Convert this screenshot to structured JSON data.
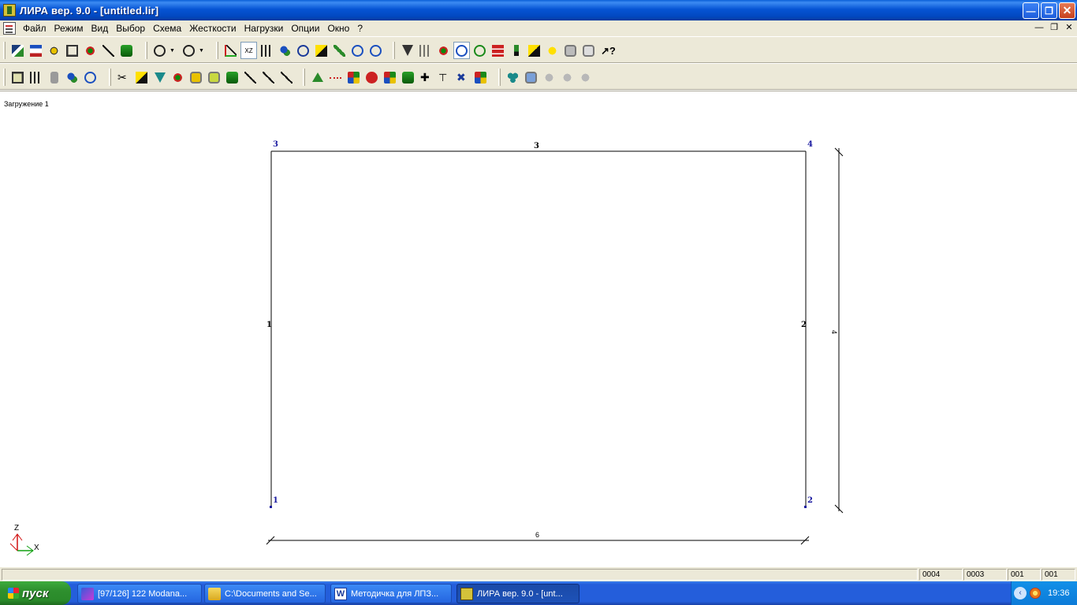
{
  "window": {
    "title": "ЛИРА  вер. 9.0 - [untitled.lir]",
    "controls": [
      "minimize",
      "restore",
      "close"
    ]
  },
  "menu": [
    "Файл",
    "Режим",
    "Вид",
    "Выбор",
    "Схема",
    "Жесткости",
    "Нагрузки",
    "Опции",
    "Окно",
    "?"
  ],
  "toolbar1": {
    "icons": [
      "new-model-icon",
      "copy-model-icon",
      "view-icon",
      "table-icon",
      "find-icon",
      "edit-icon",
      "export-icon",
      "undo-icon",
      "redo-icon",
      "axes-icon",
      "projection-xz-icon",
      "projection-yz-icon",
      "projection-xyz-icon",
      "rotate-icon",
      "flag-icon",
      "pencil-icon",
      "zoom-in-icon",
      "zoom-out-icon",
      "filter-icon",
      "fragment-icon",
      "zoom-window-icon",
      "zoom-all-icon",
      "zoom-prev-icon",
      "mesh-icon",
      "bottle-icon",
      "marker-icon",
      "highlight-icon",
      "camera-icon",
      "print-icon",
      "help-cursor-icon"
    ],
    "pressed_label": "XZ"
  },
  "toolbar2": {
    "icons": [
      "add-node-icon",
      "add-element-icon",
      "delete-icon",
      "move-icon",
      "rotate-copy-icon",
      "scissors-icon",
      "node-props-icon",
      "constraint-icon",
      "node-move-icon",
      "copy-layer-icon",
      "layers-icon",
      "stiffness-icon",
      "hinge-icon",
      "fork-icon",
      "wrench-icon",
      "support-icon",
      "load-line-icon",
      "load-node-icon",
      "target-icon",
      "dynamic-icon",
      "green-load-icon",
      "cross-icon",
      "arrow-tee-icon",
      "cross-arrows-icon",
      "mark-icon",
      "solve-icon",
      "results-icon",
      "disabled-1-icon",
      "disabled-2-icon",
      "disabled-3-icon"
    ]
  },
  "drawing": {
    "loadcase_label": "Загружение  1",
    "nodes": [
      {
        "id": "1",
        "x": 0,
        "z": 0
      },
      {
        "id": "2",
        "x": 6,
        "z": 0
      },
      {
        "id": "3",
        "x": 0,
        "z": 4
      },
      {
        "id": "4",
        "x": 6,
        "z": 4
      }
    ],
    "elements": [
      {
        "id": "1",
        "from": "1",
        "to": "3"
      },
      {
        "id": "2",
        "from": "2",
        "to": "4"
      },
      {
        "id": "3",
        "from": "3",
        "to": "4"
      }
    ],
    "dimensions": {
      "horizontal": "6",
      "vertical": "4"
    },
    "axes": {
      "vertical": "Z",
      "horizontal": "X"
    },
    "colors": {
      "node_label": "#1a1aa0",
      "element_label": "#000000",
      "axis_red": "#d01010",
      "axis_green": "#10a010"
    }
  },
  "status": [
    "0004",
    "0003",
    "001",
    "001"
  ],
  "taskbar": {
    "start_label": "пуск",
    "tasks": [
      {
        "label": "[97/126] 122 Modana...",
        "icon": "mail-icon"
      },
      {
        "label": "C:\\Documents and Se...",
        "icon": "folder-icon"
      },
      {
        "label": "Методичка для ЛПЗ...",
        "icon": "word-icon"
      },
      {
        "label": "ЛИРА  вер. 9.0 - [unt...",
        "icon": "lira-icon",
        "active": true
      }
    ],
    "clock": "19:36"
  }
}
